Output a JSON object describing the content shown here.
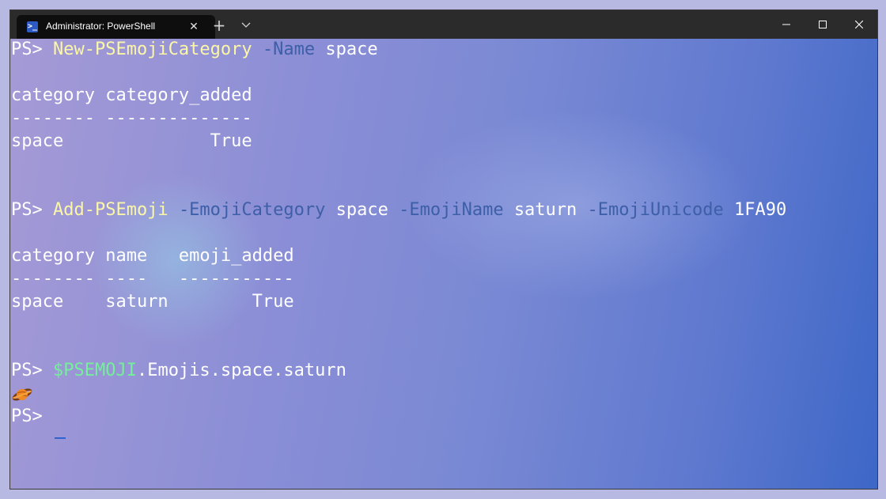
{
  "window": {
    "tab_title": "Administrator: PowerShell",
    "tab_icon": "powershell-icon",
    "new_tab_icon": "plus-icon",
    "dropdown_icon": "chevron-down-icon",
    "controls": [
      "minimize-icon",
      "maximize-icon",
      "close-icon"
    ]
  },
  "colors": {
    "command": "#fbf7a6",
    "parameter": "#3d5fa8",
    "variable": "#74ef9a",
    "text": "#ffffff",
    "cursor": "#2f63d0"
  },
  "terminal": {
    "block1": {
      "prompt": "PS> ",
      "command": "New-PSEmojiCategory",
      "param1": "-Name",
      "arg1": "space",
      "table_header": "category category_added",
      "table_divider": "-------- --------------",
      "table_row": "space              True"
    },
    "block2": {
      "prompt": "PS> ",
      "command": "Add-PSEmoji",
      "param1": "-EmojiCategory",
      "arg1": "space",
      "param2": "-EmojiName",
      "arg2": "saturn",
      "param3": "-EmojiUnicode",
      "arg3": "1FA90",
      "table_header": "category name   emoji_added",
      "table_divider": "-------- ----   -----------",
      "table_row": "space    saturn        True"
    },
    "block3": {
      "prompt": "PS> ",
      "variable": "$PSEMOJI",
      "member": ".Emojis.space.saturn",
      "output_icon": "saturn-emoji-icon"
    },
    "final_prompt": "PS> "
  }
}
